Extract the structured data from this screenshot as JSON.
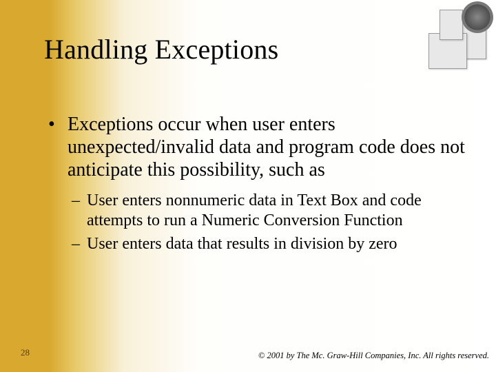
{
  "slide": {
    "title": "Handling Exceptions",
    "bullets_l1": [
      "Exceptions occur when user enters unexpected/invalid data and program code does not anticipate this possibility, such as"
    ],
    "bullets_l2": [
      "User enters nonnumeric data in Text Box and code attempts to run a Numeric Conversion Function",
      "User enters data that results in division by zero"
    ],
    "page_number": "28",
    "copyright": "© 2001 by The Mc. Graw-Hill Companies, Inc. All rights reserved.",
    "l1_marker": "•",
    "l2_marker": "–"
  }
}
